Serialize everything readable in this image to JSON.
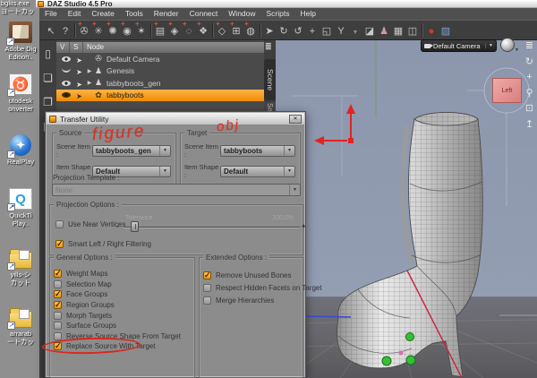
{
  "window": {
    "title": "DAZ Studio 4.5 Pro"
  },
  "menu": {
    "items": [
      "File",
      "Edit",
      "Create",
      "Tools",
      "Render",
      "Connect",
      "Window",
      "Scripts",
      "Help"
    ]
  },
  "toolbar": {
    "icons": [
      {
        "name": "whats-this-icon",
        "glyph": "↖",
        "plus": false,
        "cls": ""
      },
      {
        "name": "help-icon",
        "glyph": "?",
        "plus": false,
        "cls": ""
      },
      {
        "name": "separator",
        "glyph": "",
        "plus": false,
        "cls": "sep"
      },
      {
        "name": "new-camera-icon",
        "glyph": "✇",
        "plus": true,
        "cls": ""
      },
      {
        "name": "new-distant-light-icon",
        "glyph": "✳",
        "plus": true,
        "cls": ""
      },
      {
        "name": "new-point-light-icon",
        "glyph": "✺",
        "plus": true,
        "cls": ""
      },
      {
        "name": "new-linear-light-icon",
        "glyph": "◉",
        "plus": true,
        "cls": ""
      },
      {
        "name": "new-spotlight-icon",
        "glyph": "✶",
        "plus": true,
        "cls": ""
      },
      {
        "name": "separator",
        "glyph": "",
        "plus": false,
        "cls": "sep"
      },
      {
        "name": "new-perspective-camera-icon",
        "glyph": "▤",
        "plus": true,
        "cls": ""
      },
      {
        "name": "new-node-icon",
        "glyph": "◈",
        "plus": true,
        "cls": ""
      },
      {
        "name": "new-null-icon",
        "glyph": "◌",
        "plus": true,
        "cls": ""
      },
      {
        "name": "new-prop-icon",
        "glyph": "❖",
        "plus": true,
        "cls": ""
      },
      {
        "name": "separator",
        "glyph": "",
        "plus": false,
        "cls": "sep"
      },
      {
        "name": "new-group-icon",
        "glyph": "◇",
        "plus": true,
        "cls": ""
      },
      {
        "name": "new-instance-icon",
        "glyph": "⊞",
        "plus": true,
        "cls": ""
      },
      {
        "name": "new-instance-group-icon",
        "glyph": "◍",
        "plus": true,
        "cls": ""
      },
      {
        "name": "separator",
        "glyph": "",
        "plus": false,
        "cls": "sep"
      },
      {
        "name": "node-selection-tool-icon",
        "glyph": "➤",
        "plus": false,
        "cls": ""
      },
      {
        "name": "orbit-tool-icon",
        "glyph": "↻",
        "plus": false,
        "cls": ""
      },
      {
        "name": "rotate-tool-icon",
        "glyph": "↺",
        "plus": false,
        "cls": ""
      },
      {
        "name": "translate-tool-icon",
        "glyph": "+",
        "plus": false,
        "cls": ""
      },
      {
        "name": "scale-tool-icon",
        "glyph": "◱",
        "plus": false,
        "cls": ""
      },
      {
        "name": "bone-tool-icon",
        "glyph": "Y",
        "plus": false,
        "cls": ""
      },
      {
        "name": "tool-dropdown-icon",
        "glyph": "▼",
        "plus": false,
        "cls": "dim"
      },
      {
        "name": "surface-selection-icon",
        "glyph": "◪",
        "plus": false,
        "cls": ""
      },
      {
        "name": "figure-icon",
        "glyph": "♟",
        "plus": false,
        "cls": "pink"
      },
      {
        "name": "uv-view-icon",
        "glyph": "▦",
        "plus": false,
        "cls": ""
      },
      {
        "name": "people-icon",
        "glyph": "◫",
        "plus": false,
        "cls": ""
      },
      {
        "name": "separator",
        "glyph": "",
        "plus": false,
        "cls": "sep"
      },
      {
        "name": "render-icon",
        "glyph": "●",
        "plus": false,
        "cls": "red"
      },
      {
        "name": "aux-viewport-icon",
        "glyph": "▨",
        "plus": false,
        "cls": "blue"
      }
    ]
  },
  "file_toolbar": {
    "icons": [
      {
        "name": "new-file-icon",
        "glyph": "▯"
      },
      {
        "name": "open-file-icon",
        "glyph": "❏"
      },
      {
        "name": "merge-file-icon",
        "glyph": "❐"
      },
      {
        "name": "save-file-icon",
        "glyph": "▣"
      }
    ]
  },
  "scene": {
    "tab": "Scene",
    "tab_partial": "Sm",
    "columns": [
      "V",
      "S",
      "Node"
    ],
    "rows": [
      {
        "label": "Default Camera",
        "glyph": "✇",
        "eye": "open",
        "expand": "",
        "cls": ""
      },
      {
        "label": "Genesis",
        "glyph": "♟",
        "eye": "closed",
        "expand": "▶",
        "cls": ""
      },
      {
        "label": "tabbyboots_gen",
        "glyph": "♟",
        "eye": "open",
        "expand": "▶",
        "cls": ""
      },
      {
        "label": "tabbyboots",
        "glyph": "✿",
        "eye": "open",
        "expand": "",
        "cls": "sel"
      }
    ]
  },
  "viewport": {
    "camera": "Default Camera",
    "cube_label": "Left",
    "side_tools": [
      {
        "name": "pane-options-icon",
        "glyph": "≣"
      },
      {
        "name": "orbit-view-icon",
        "glyph": "↻"
      },
      {
        "name": "pan-view-icon",
        "glyph": "+"
      },
      {
        "name": "zoom-view-icon",
        "glyph": "⚲"
      },
      {
        "name": "frame-view-icon",
        "glyph": "⊡"
      },
      {
        "name": "reset-view-icon",
        "glyph": "↥"
      }
    ]
  },
  "dialog": {
    "title": "Transfer Utility",
    "close_glyph": "✕",
    "source_group": "Source",
    "target_group": "Target",
    "scene_item_label": "Scene Item :",
    "item_shape_label": "Item Shape :",
    "source_scene_item": "tabbyboots_gen",
    "source_item_shape": "Default",
    "target_scene_item": "tabbyboots",
    "target_item_shape": "Default",
    "projection_template_label": "Projection Template :",
    "projection_template_value": "None",
    "projection_options_label": "Projection Options :",
    "use_near_vertices": {
      "label": "Use Near Vertices",
      "checked": false
    },
    "tolerance_label": "Tolerance",
    "tolerance_value": "100.0%",
    "slider_minus": "-",
    "slider_plus": "+",
    "smart_lr": {
      "label": "Smart Left / Right Filtering",
      "checked": true
    },
    "general_label": "General Options :",
    "extended_label": "Extended Options :",
    "general_options": [
      {
        "label": "Weight Maps",
        "checked": true
      },
      {
        "label": "Selection Map",
        "checked": false
      },
      {
        "label": "Face Groups",
        "checked": true
      },
      {
        "label": "Region Groups",
        "checked": true
      },
      {
        "label": "Morph Targets",
        "checked": false
      },
      {
        "label": "Surface Groups",
        "checked": false
      },
      {
        "label": "Reverse Source Shape From Target",
        "checked": false
      },
      {
        "label": "Replace Source With Target",
        "checked": true
      }
    ],
    "extended_options": [
      {
        "label": "Remove Unused Bones",
        "checked": true
      },
      {
        "label": "Respect Hidden Facets on Target",
        "checked": false
      },
      {
        "label": "Merge Hierarchies",
        "checked": false
      }
    ]
  },
  "annotations": {
    "source_note": "figure",
    "target_note": "obj"
  },
  "desktop": {
    "top_label_1": "bglits.exe",
    "top_label_2": "ヨートカッ",
    "icons": [
      {
        "name": "adobe-digital-editions-icon",
        "type": "dt-book",
        "glyph": "",
        "label1": "Adobe Dig",
        "label2": "Edition.."
      },
      {
        "name": "autodesk-converter-icon",
        "type": "dt-bull",
        "glyph": "♉",
        "label1": "utodesk",
        "label2": "onverter"
      },
      {
        "name": "realplayer-icon",
        "type": "dt-real",
        "glyph": "✦",
        "label1": "RealPlay",
        "label2": ""
      },
      {
        "name": "quicktime-player-icon",
        "type": "dt-qt",
        "glyph": "Q",
        "label1": "QuickTi",
        "label2": "Play.."
      },
      {
        "name": "folder-shortcut-icon",
        "type": "dt-folder",
        "glyph": "",
        "label1": "yills-シ",
        "label2": "カット"
      },
      {
        "name": "folder-shortcut-icon",
        "type": "dt-folder",
        "glyph": "",
        "label1": "arrarab",
        "label2": "ートカッ"
      }
    ]
  },
  "colors": {
    "selection_orange": "#ef8b00",
    "annotation_red": "#da3022",
    "viewport_sky": "#8c96ac",
    "checked_orange": "#ee9711",
    "joint_green": "#35c135"
  }
}
